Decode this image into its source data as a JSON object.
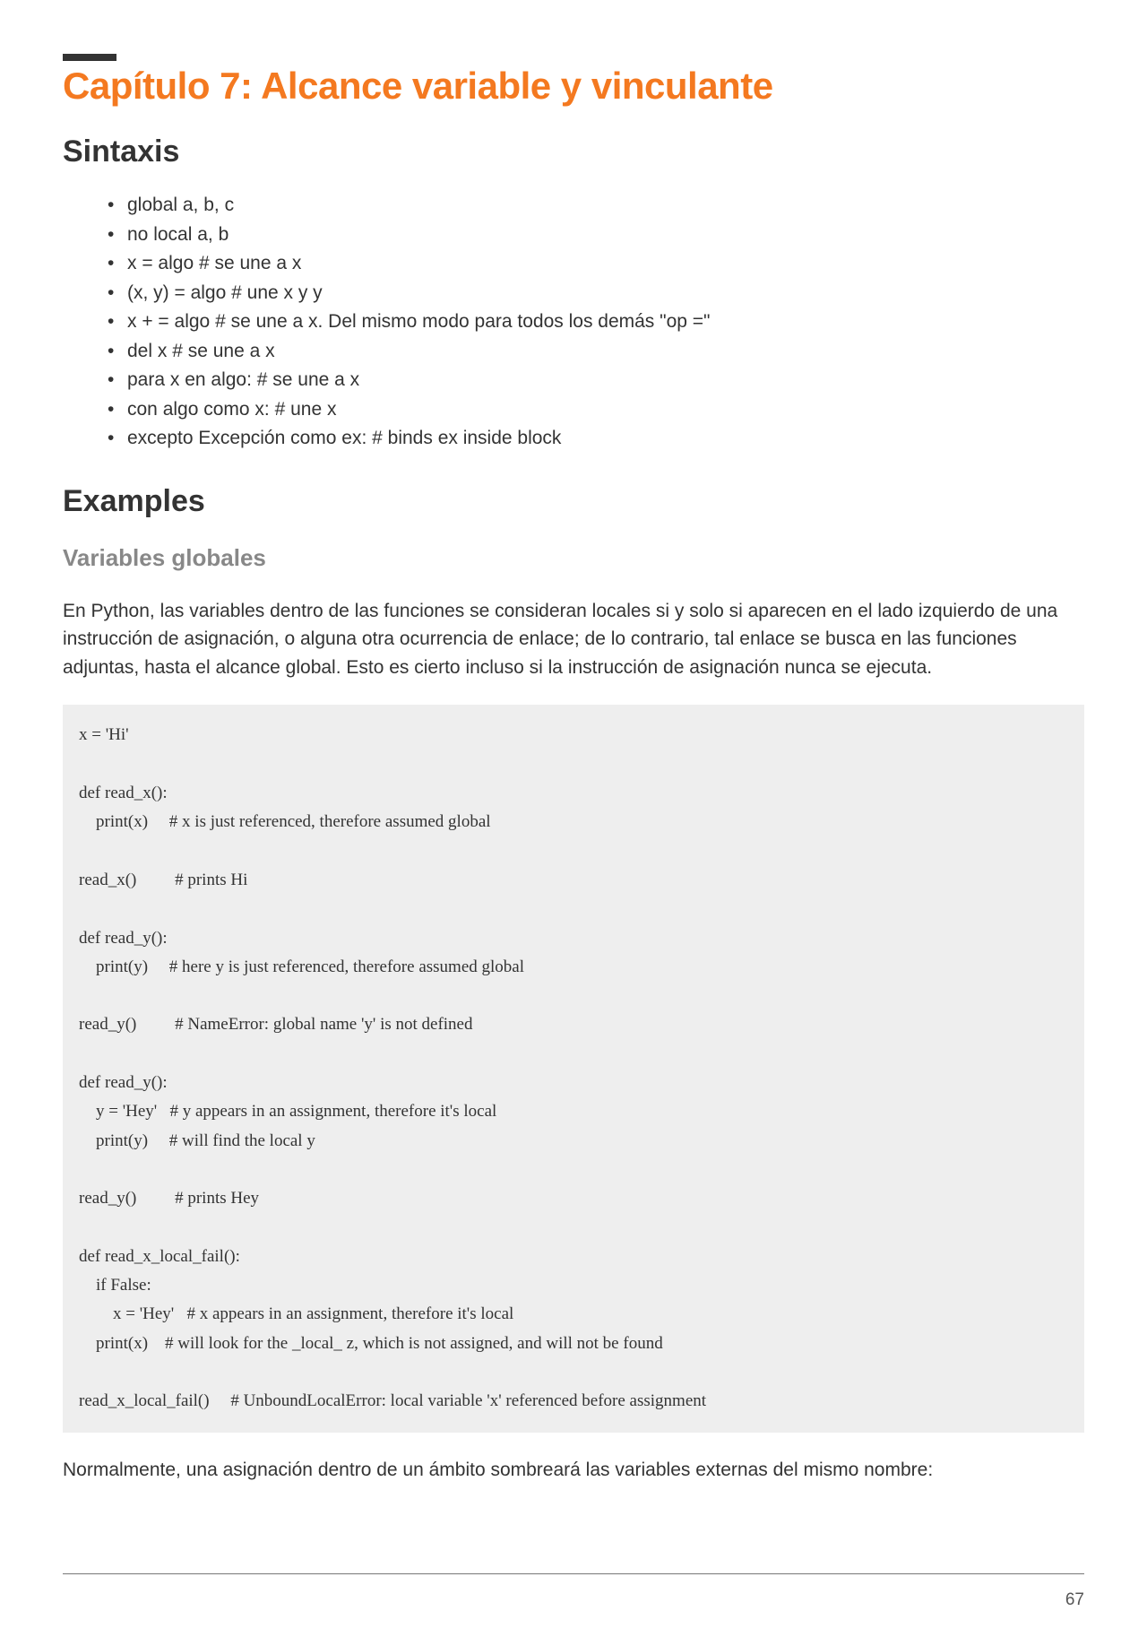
{
  "chapter": {
    "title": "Capítulo 7: Alcance variable y vinculante"
  },
  "sections": {
    "syntax": {
      "heading": "Sintaxis",
      "items": [
        "global a, b, c",
        "no local a, b",
        "x = algo # se une a x",
        "(x, y) = algo # une x y y",
        "x + = algo # se une a x. Del mismo modo para todos los demás \"op =\"",
        "del x # se une a x",
        "para x en algo: # se une a x",
        "con algo como x: # une x",
        "excepto Excepción como ex: # binds ex inside block"
      ]
    },
    "examples": {
      "heading": "Examples",
      "subsection": "Variables globales",
      "intro": "En Python, las variables dentro de las funciones se consideran locales si y solo si aparecen en el lado izquierdo de una instrucción de asignación, o alguna otra ocurrencia de enlace; de lo contrario, tal enlace se busca en las funciones adjuntas, hasta el alcance global. Esto es cierto incluso si la instrucción de asignación nunca se ejecuta.",
      "code": "x = 'Hi'\n\ndef read_x():\n    print(x)     # x is just referenced, therefore assumed global\n\nread_x()         # prints Hi\n\ndef read_y():\n    print(y)     # here y is just referenced, therefore assumed global\n\nread_y()         # NameError: global name 'y' is not defined\n\ndef read_y():\n    y = 'Hey'   # y appears in an assignment, therefore it's local\n    print(y)     # will find the local y\n\nread_y()         # prints Hey\n\ndef read_x_local_fail():\n    if False:\n        x = 'Hey'   # x appears in an assignment, therefore it's local\n    print(x)    # will look for the _local_ z, which is not assigned, and will not be found\n\nread_x_local_fail()     # UnboundLocalError: local variable 'x' referenced before assignment",
      "outro": "Normalmente, una asignación dentro de un ámbito sombreará las variables externas del mismo nombre:"
    }
  },
  "page_number": "67"
}
